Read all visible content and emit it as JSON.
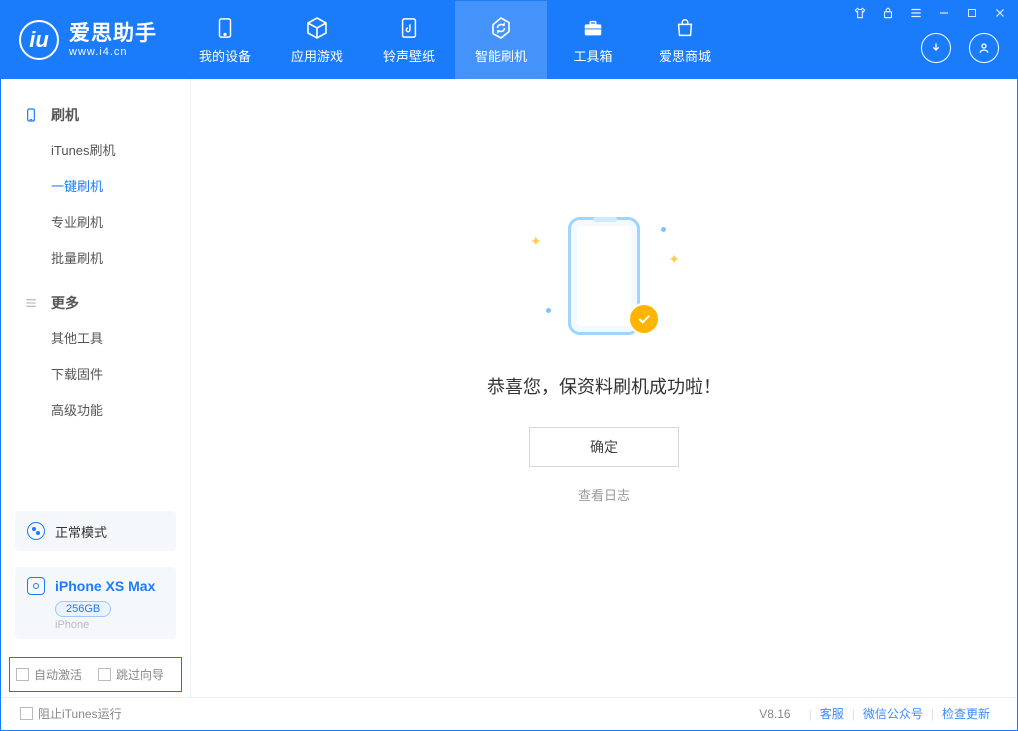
{
  "brand": {
    "title": "爱思助手",
    "subtitle": "www.i4.cn"
  },
  "nav": {
    "items": [
      {
        "label": "我的设备"
      },
      {
        "label": "应用游戏"
      },
      {
        "label": "铃声壁纸"
      },
      {
        "label": "智能刷机"
      },
      {
        "label": "工具箱"
      },
      {
        "label": "爱思商城"
      }
    ]
  },
  "sidebar": {
    "section_flash": {
      "title": "刷机",
      "items": [
        {
          "label": "iTunes刷机"
        },
        {
          "label": "一键刷机"
        },
        {
          "label": "专业刷机"
        },
        {
          "label": "批量刷机"
        }
      ]
    },
    "section_more": {
      "title": "更多",
      "items": [
        {
          "label": "其他工具"
        },
        {
          "label": "下载固件"
        },
        {
          "label": "高级功能"
        }
      ]
    },
    "mode": {
      "label": "正常模式"
    },
    "device": {
      "name": "iPhone XS Max",
      "capacity": "256GB",
      "type": "iPhone"
    },
    "checks": {
      "auto_activate": "自动激活",
      "skip_guide": "跳过向导"
    }
  },
  "main": {
    "title": "恭喜您，保资料刷机成功啦！",
    "ok": "确定",
    "logs": "查看日志"
  },
  "footer": {
    "block_itunes": "阻止iTunes运行",
    "version": "V8.16",
    "links": {
      "cs": "客服",
      "wechat": "微信公众号",
      "update": "检查更新"
    }
  }
}
